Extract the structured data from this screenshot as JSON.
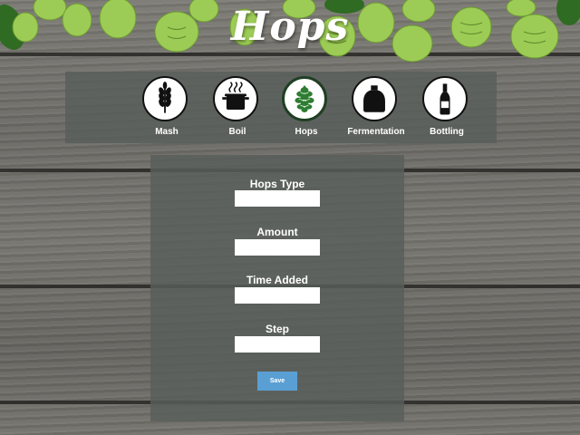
{
  "header": {
    "title": "Hops"
  },
  "nav": {
    "items": [
      {
        "label": "Mash",
        "icon": "wheat-icon",
        "active": false
      },
      {
        "label": "Boil",
        "icon": "boil-pot-icon",
        "active": false
      },
      {
        "label": "Hops",
        "icon": "hop-cone-icon",
        "active": true
      },
      {
        "label": "Fermentation",
        "icon": "carboy-icon",
        "active": false
      },
      {
        "label": "Bottling",
        "icon": "bottle-icon",
        "active": false
      }
    ]
  },
  "form": {
    "fields": [
      {
        "label": "Hops Type",
        "value": ""
      },
      {
        "label": "Amount",
        "value": ""
      },
      {
        "label": "Time Added",
        "value": ""
      },
      {
        "label": "Step",
        "value": ""
      }
    ],
    "save_label": "Save"
  },
  "colors": {
    "panel": "#585e5a",
    "save_button": "#5a9fd4",
    "hop_green": "#8fc24a",
    "active_ring": "#1f3f24"
  }
}
